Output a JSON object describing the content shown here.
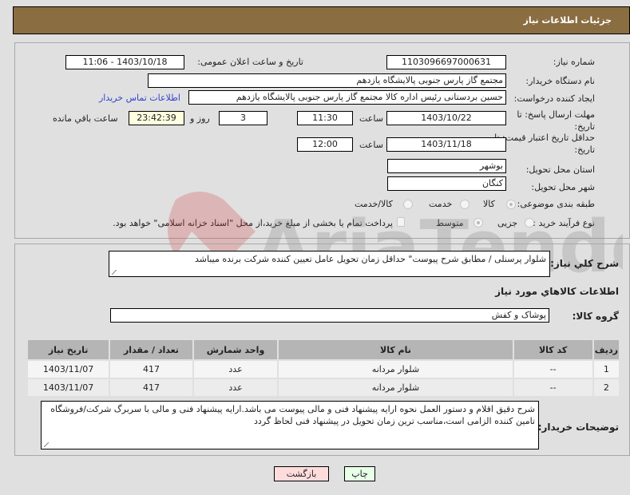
{
  "header": {
    "title": "جزئیات اطلاعات نیاز"
  },
  "form": {
    "need_number": {
      "label": "شماره نیاز:",
      "value": "1103096697000631"
    },
    "announce_datetime": {
      "label": "تاریخ و ساعت اعلان عمومی:",
      "value": "1403/10/18 - 11:06"
    },
    "buyer_org": {
      "label": "نام دستگاه خریدار:",
      "value": "مجتمع گاز پارس جنوبی  پالایشگاه یازدهم"
    },
    "requester": {
      "label": "ایجاد کننده درخواست:",
      "value": "حسین بردستانی رئیس اداره کالا مجتمع گاز پارس جنوبی  پالایشگاه یازدهم"
    },
    "buyer_contact_link": "اطلاعات تماس خریدار",
    "reply_deadline": {
      "label_line1": "مهلت ارسال پاسخ: تا",
      "label_line2": "تاریخ:",
      "date": "1403/10/22",
      "time_label": "ساعت",
      "time": "11:30",
      "days": "3",
      "days_label": "روز و",
      "remaining": "23:42:39",
      "remaining_label": "ساعت باقي مانده"
    },
    "price_validity": {
      "label_line1": "حداقل تاریخ اعتبار قیمت: تا",
      "label_line2": "تاریخ:",
      "date": "1403/11/18",
      "time_label": "ساعت",
      "time": "12:00"
    },
    "delivery_province": {
      "label": "استان محل تحویل:",
      "value": "بوشهر"
    },
    "delivery_city": {
      "label": "شهر محل تحویل:",
      "value": "کنگان"
    },
    "category": {
      "label": "طبقه بندی موضوعی:",
      "options": [
        "کالا",
        "خدمت",
        "کالا/خدمت"
      ],
      "selected": "کالا"
    },
    "purchase_type": {
      "label": "نوع فرآیند خرید :",
      "options": [
        "جزیی",
        "متوسط"
      ],
      "selected": "متوسط",
      "treasury_checkbox_label": "پرداخت تمام یا بخشی از مبلغ خرید،از محل \"اسناد خزانه اسلامی\" خواهد بود."
    }
  },
  "description": {
    "label": "شرح کلي نیاز:",
    "value": "شلوار پرسنلی / مطابق شرح پیوست\" حداقل زمان تحویل عامل تعیین کننده شرکت برنده میباشد"
  },
  "goods_section": {
    "title": "اطلاعات کالاهاي مورد نیاز",
    "group_label": "گروه کالا:",
    "group_value": "پوشاک و کفش",
    "table": {
      "headers": [
        "ردیف",
        "کد کالا",
        "نام کالا",
        "واحد شمارش",
        "تعداد / مقدار",
        "تاریخ نیاز"
      ],
      "rows": [
        [
          "1",
          "--",
          "شلوار مردانه",
          "عدد",
          "417",
          "1403/11/07"
        ],
        [
          "2",
          "--",
          "شلوار مردانه",
          "عدد",
          "417",
          "1403/11/07"
        ]
      ]
    }
  },
  "buyer_notes": {
    "label": "توضیحات خریدار:",
    "value": "شرح دقیق اقلام و دستور العمل نحوه ارایه پیشنهاد فنی و مالی پیوست می باشد.ارایه پیشنهاد فنی و مالی با سربرگ شرکت/فروشگاه تامین کننده الزامی است،مناسب ترین زمان تحویل در پیشنهاد فنی لحاظ گردد"
  },
  "buttons": {
    "print": "چاپ",
    "back": "بازگشت"
  },
  "colors": {
    "header_bg": "#8b6d42",
    "print_bg": "#e8ffe8",
    "back_bg": "#ffdcdc",
    "link": "#3344cc"
  },
  "watermark": {
    "text": "AriaTender.neT"
  }
}
